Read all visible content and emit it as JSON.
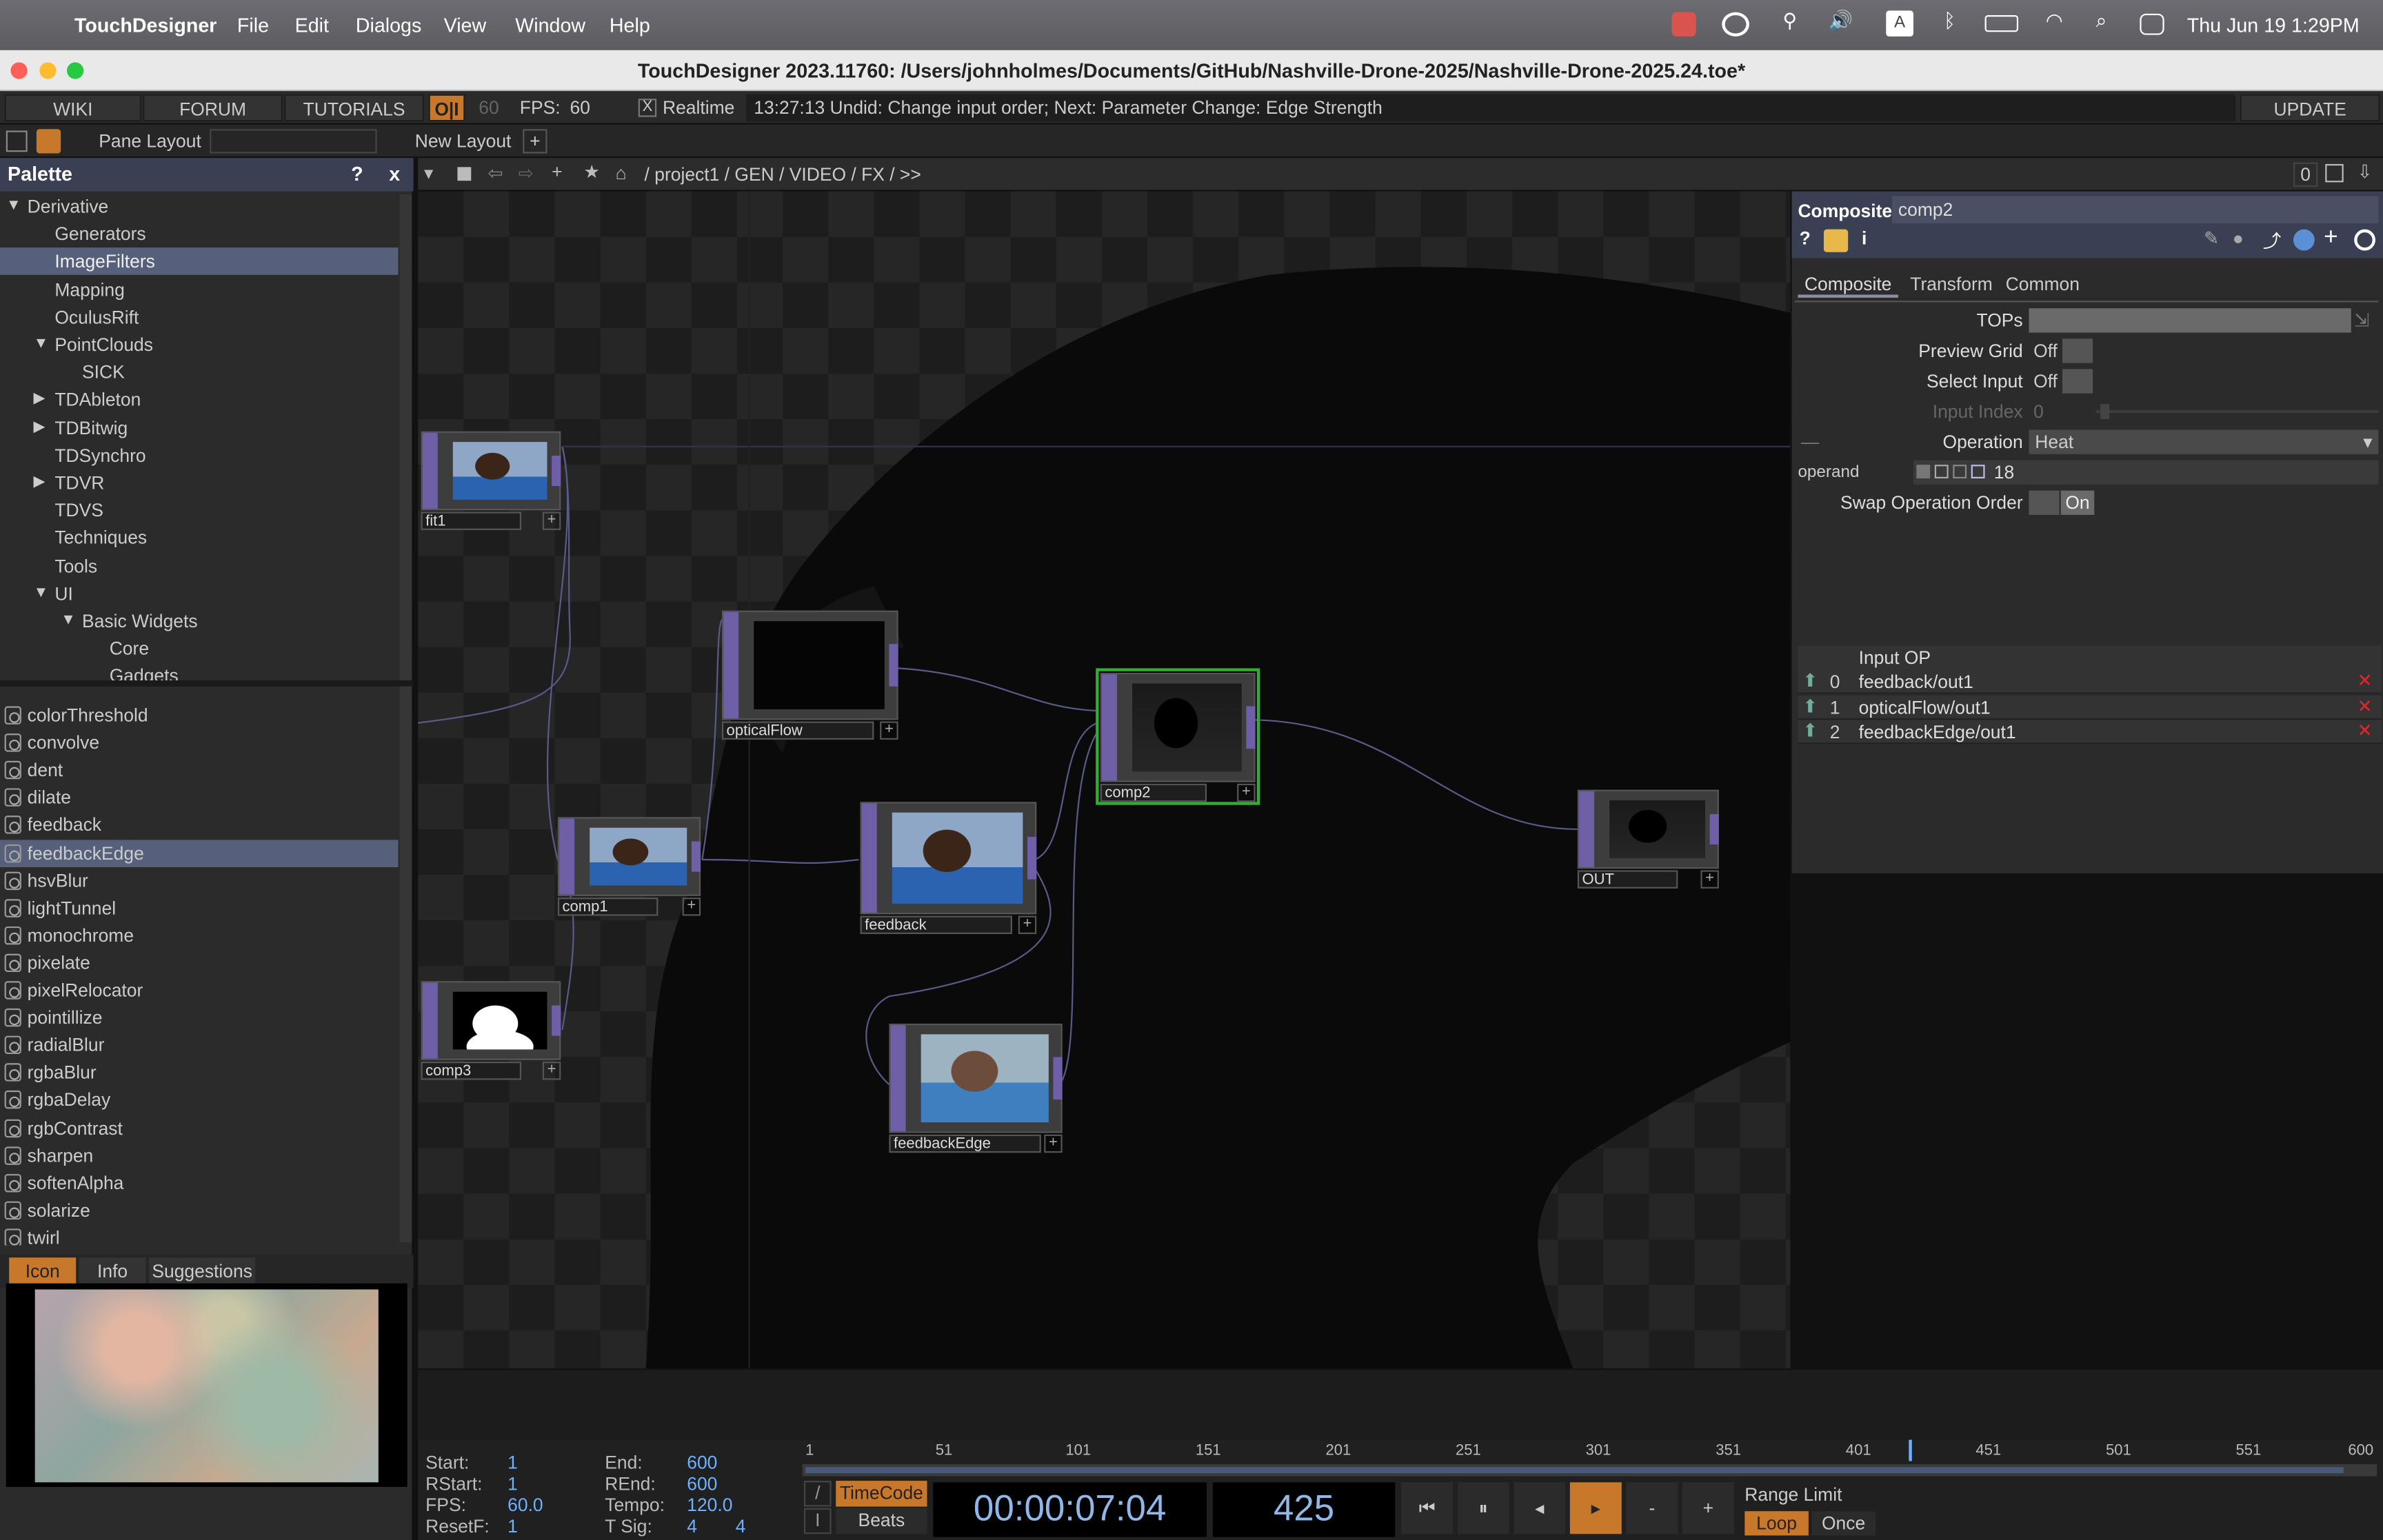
{
  "menubar": {
    "app": "TouchDesigner",
    "items": [
      "File",
      "Edit",
      "Dialogs",
      "View",
      "Window",
      "Help"
    ],
    "keyboard_indicator": "A",
    "clock": "Thu Jun 19  1:29PM"
  },
  "window": {
    "title": "TouchDesigner 2023.11760: /Users/johnholmes/Documents/GitHub/Nashville-Drone-2025/Nashville-Drone-2025.24.toe*"
  },
  "toolbar": {
    "wiki": "WIKI",
    "forum": "FORUM",
    "tutorials": "TUTORIALS",
    "oi": "O|I",
    "fps_target": "60",
    "fps_label": "FPS:",
    "fps_value": "60",
    "realtime_check": "X",
    "realtime": "Realtime",
    "status": "13:27:13 Undid: Change input order; Next: Parameter Change: Edge Strength",
    "update": "UPDATE"
  },
  "layout_bar": {
    "pane_layout": "Pane Layout",
    "new_layout": "New Layout",
    "add": "+"
  },
  "net_bar": {
    "path": "/ project1 / GEN / VIDEO / FX / >>",
    "counter": "0"
  },
  "palette": {
    "title": "Palette",
    "help": "?",
    "close": "x",
    "tree": [
      {
        "label": "Derivative",
        "indent": 0,
        "arrow": "down",
        "selected": false
      },
      {
        "label": "Generators",
        "indent": 1,
        "arrow": "",
        "selected": false
      },
      {
        "label": "ImageFilters",
        "indent": 1,
        "arrow": "",
        "selected": true
      },
      {
        "label": "Mapping",
        "indent": 1,
        "arrow": "",
        "selected": false
      },
      {
        "label": "OculusRift",
        "indent": 1,
        "arrow": "",
        "selected": false
      },
      {
        "label": "PointClouds",
        "indent": 1,
        "arrow": "down",
        "selected": false
      },
      {
        "label": "SICK",
        "indent": 2,
        "arrow": "",
        "selected": false
      },
      {
        "label": "TDAbleton",
        "indent": 1,
        "arrow": "right",
        "selected": false
      },
      {
        "label": "TDBitwig",
        "indent": 1,
        "arrow": "right",
        "selected": false
      },
      {
        "label": "TDSynchro",
        "indent": 1,
        "arrow": "",
        "selected": false
      },
      {
        "label": "TDVR",
        "indent": 1,
        "arrow": "right",
        "selected": false
      },
      {
        "label": "TDVS",
        "indent": 1,
        "arrow": "",
        "selected": false
      },
      {
        "label": "Techniques",
        "indent": 1,
        "arrow": "",
        "selected": false
      },
      {
        "label": "Tools",
        "indent": 1,
        "arrow": "",
        "selected": false
      },
      {
        "label": "UI",
        "indent": 1,
        "arrow": "down",
        "selected": false
      },
      {
        "label": "Basic Widgets",
        "indent": 2,
        "arrow": "down",
        "selected": false
      },
      {
        "label": "Core",
        "indent": 3,
        "arrow": "",
        "selected": false
      },
      {
        "label": "Gadgets",
        "indent": 3,
        "arrow": "",
        "selected": false
      }
    ],
    "components": [
      {
        "label": "colorThreshold",
        "selected": false
      },
      {
        "label": "convolve",
        "selected": false
      },
      {
        "label": "dent",
        "selected": false
      },
      {
        "label": "dilate",
        "selected": false
      },
      {
        "label": "feedback",
        "selected": false
      },
      {
        "label": "feedbackEdge",
        "selected": true
      },
      {
        "label": "hsvBlur",
        "selected": false
      },
      {
        "label": "lightTunnel",
        "selected": false
      },
      {
        "label": "monochrome",
        "selected": false
      },
      {
        "label": "pixelate",
        "selected": false
      },
      {
        "label": "pixelRelocator",
        "selected": false
      },
      {
        "label": "pointillize",
        "selected": false
      },
      {
        "label": "radialBlur",
        "selected": false
      },
      {
        "label": "rgbaBlur",
        "selected": false
      },
      {
        "label": "rgbaDelay",
        "selected": false
      },
      {
        "label": "rgbContrast",
        "selected": false
      },
      {
        "label": "sharpen",
        "selected": false
      },
      {
        "label": "softenAlpha",
        "selected": false
      },
      {
        "label": "solarize",
        "selected": false
      },
      {
        "label": "twirl",
        "selected": false
      }
    ],
    "tabs": [
      "Icon",
      "Info",
      "Suggestions"
    ],
    "active_tab": "Icon"
  },
  "nodes": [
    {
      "name": "fit1",
      "thumb": "face"
    },
    {
      "name": "opticalFlow",
      "thumb": "black"
    },
    {
      "name": "comp2",
      "thumb": "silhouette",
      "selected": true
    },
    {
      "name": "comp1",
      "thumb": "face"
    },
    {
      "name": "feedback",
      "thumb": "face"
    },
    {
      "name": "OUT",
      "thumb": "silhouette"
    },
    {
      "name": "comp3",
      "thumb": "mask"
    },
    {
      "name": "feedbackEdge",
      "thumb": "face_edge"
    }
  ],
  "params": {
    "op_type": "Composite",
    "op_name": "comp2",
    "tabs": [
      "Composite",
      "Transform",
      "Common"
    ],
    "active_tab": "Composite",
    "rows": {
      "tops_label": "TOPs",
      "preview_grid_label": "Preview Grid",
      "preview_grid_value": "Off",
      "select_input_label": "Select Input",
      "select_input_value": "Off",
      "input_index_label": "Input Index",
      "input_index_value": "0",
      "operation_label": "Operation",
      "operation_value": "Heat",
      "operand_label": "operand",
      "operand_value": "18",
      "swap_label": "Swap Operation Order",
      "swap_value": "On"
    },
    "input_op_header": "Input OP",
    "inputs": [
      {
        "index": "0",
        "path": "feedback/out1"
      },
      {
        "index": "1",
        "path": "opticalFlow/out1"
      },
      {
        "index": "2",
        "path": "feedbackEdge/out1"
      }
    ]
  },
  "timeline": {
    "start_label": "Start:",
    "start": "1",
    "end_label": "End:",
    "end": "600",
    "rstart_label": "RStart:",
    "rstart": "1",
    "rend_label": "REnd:",
    "rend": "600",
    "fps_label": "FPS:",
    "fps": "60.0",
    "tempo_label": "Tempo:",
    "tempo": "120.0",
    "resetf_label": "ResetF:",
    "resetf": "1",
    "tsig_label": "T Sig:",
    "tsig_a": "4",
    "tsig_b": "4",
    "ticks": [
      "1",
      "51",
      "101",
      "151",
      "201",
      "251",
      "301",
      "351",
      "401",
      "451",
      "501",
      "551",
      "600"
    ],
    "playhead_frame": 425,
    "range_max": 600,
    "timecode_btn": "TimeCode",
    "beats_btn": "Beats",
    "timecode": "00:00:07:04",
    "frame": "425",
    "range_limit": "Range Limit",
    "loop": "Loop",
    "once": "Once",
    "minus": "-",
    "plus": "+"
  },
  "colors": {
    "accent_orange": "#c8782a",
    "node_flag_purple": "#6e5fa6",
    "selected_green": "#2fae2f",
    "header_blue": "#3a3f53",
    "timecode_blue": "#6fb0ff",
    "close_red": "#e0262b"
  }
}
